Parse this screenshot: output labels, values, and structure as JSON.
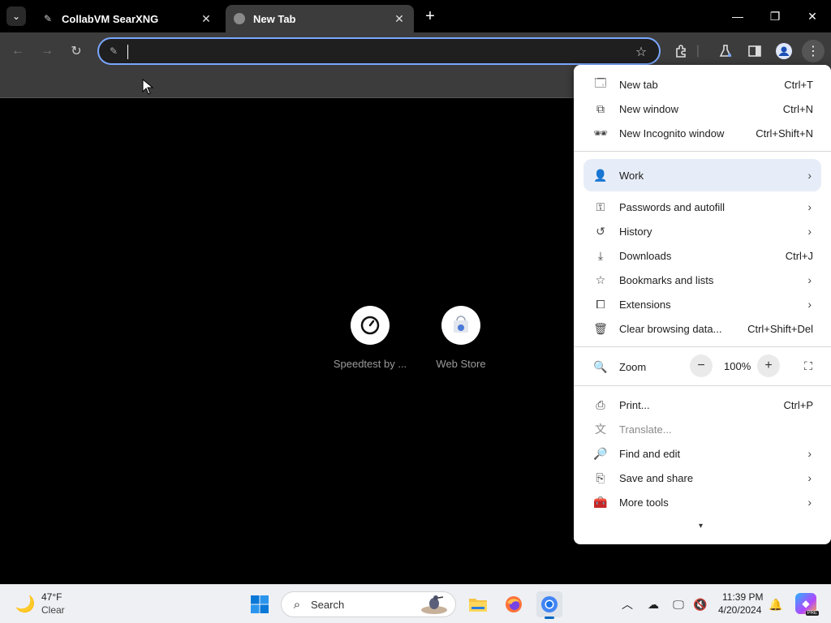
{
  "browser": {
    "tabs": [
      {
        "title": "CollabVM SearXNG",
        "active": false
      },
      {
        "title": "New Tab",
        "active": true
      }
    ],
    "omnibox": {
      "value": "",
      "placeholder": ""
    }
  },
  "new_tab_page": {
    "shortcuts": [
      {
        "label": "Speedtest by ...",
        "icon": "speedtest-icon"
      },
      {
        "label": "Web Store",
        "icon": "web-store-icon"
      }
    ]
  },
  "menu": {
    "items": {
      "new_tab": {
        "label": "New tab",
        "shortcut": "Ctrl+T"
      },
      "new_window": {
        "label": "New window",
        "shortcut": "Ctrl+N"
      },
      "new_incognito": {
        "label": "New Incognito window",
        "shortcut": "Ctrl+Shift+N"
      },
      "profile": {
        "label": "Work"
      },
      "passwords": {
        "label": "Passwords and autofill"
      },
      "history": {
        "label": "History"
      },
      "downloads": {
        "label": "Downloads",
        "shortcut": "Ctrl+J"
      },
      "bookmarks": {
        "label": "Bookmarks and lists"
      },
      "extensions": {
        "label": "Extensions"
      },
      "clear_data": {
        "label": "Clear browsing data...",
        "shortcut": "Ctrl+Shift+Del"
      },
      "zoom": {
        "label": "Zoom",
        "value": "100%"
      },
      "print": {
        "label": "Print...",
        "shortcut": "Ctrl+P"
      },
      "translate": {
        "label": "Translate..."
      },
      "find_edit": {
        "label": "Find and edit"
      },
      "save_share": {
        "label": "Save and share"
      },
      "more_tools": {
        "label": "More tools"
      }
    }
  },
  "taskbar": {
    "weather": {
      "temp": "47°F",
      "condition": "Clear"
    },
    "search_label": "Search",
    "clock": {
      "time": "11:39 PM",
      "date": "4/20/2024"
    },
    "copilot_badge": "PRE"
  },
  "colors": {
    "accent": "#7aa7ff",
    "menu_highlight": "#e7edf8",
    "taskbar": "#eef0f4"
  }
}
